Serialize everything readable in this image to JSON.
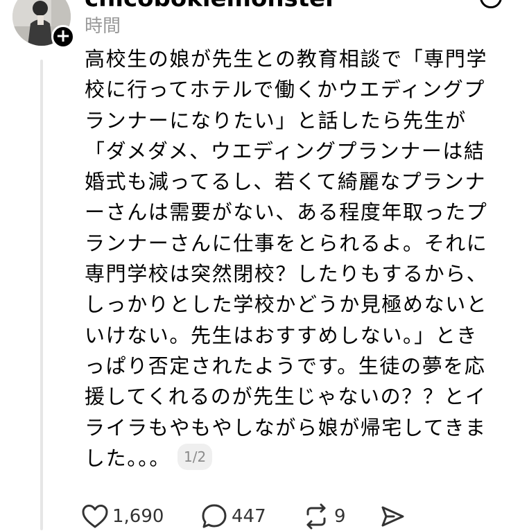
{
  "header": {
    "username": "chicobokiemonster",
    "more_icon": "more-circle-icon"
  },
  "post": {
    "timestamp": "時間",
    "follow_icon": "plus-icon",
    "lines": [
      "高校生の娘が先生との教育相談で「専門学",
      "校に行ってホテルで働くかウエディングプ",
      "ランナーになりたい」と話したら先生が",
      "「ダメダメ、ウエディングプランナーは結",
      "婚式も減ってるし、若くて綺麗なプランナ",
      "ーさんは需要がない、ある程度年取ったプ",
      "ランナーさんに仕事をとられるよ。それに",
      "専門学校は突然閉校？したりもするから、",
      "しっかりとした学校かどうか見極めないと",
      "いけない。先生はおすすめしない。」とき",
      "っぱり否定されたようです。生徒の夢を応",
      "援してくれるのが先生じゃないの？？とイ",
      "ライラもやもやしながら娘が帰宅してきま",
      "した。。。"
    ],
    "page_indicator": "1/2"
  },
  "actions": {
    "like": {
      "icon": "heart-icon",
      "count": "1,690"
    },
    "reply": {
      "icon": "comment-icon",
      "count": "447"
    },
    "repost": {
      "icon": "repost-icon",
      "count": "9"
    },
    "share": {
      "icon": "send-icon"
    }
  }
}
